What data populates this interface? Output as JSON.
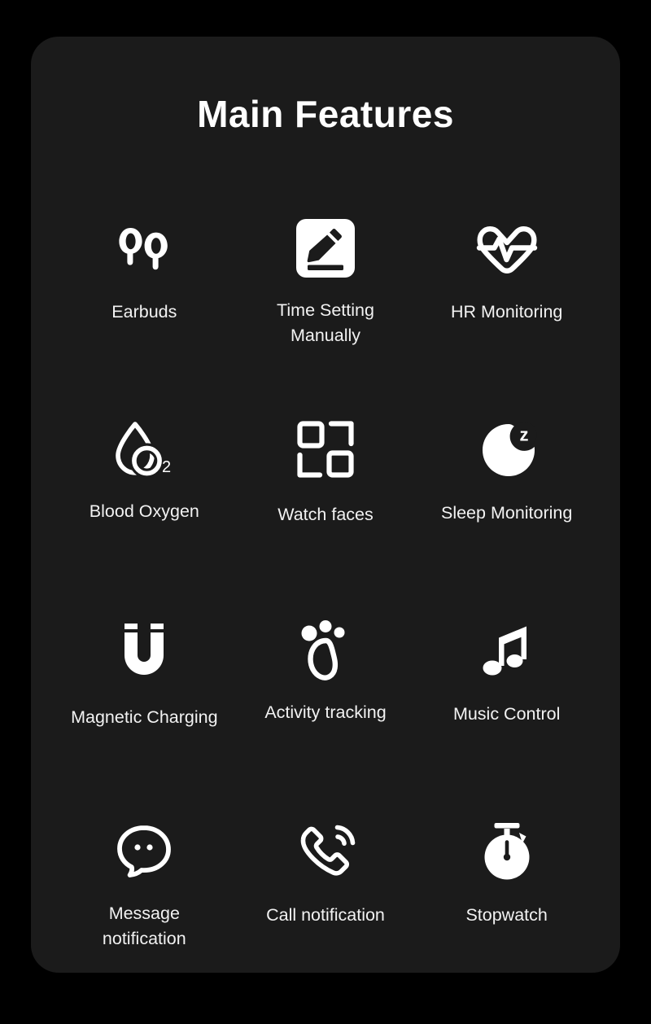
{
  "theme": {
    "page_background": "#000000",
    "card_background": "#1b1b1b",
    "text_color": "#ffffff",
    "icon_color": "#ffffff"
  },
  "card": {
    "title": "Main Features"
  },
  "features": [
    {
      "label": "Earbuds",
      "icon": "earbuds-icon"
    },
    {
      "label": "Time Setting\nManually",
      "icon": "pencil-edit-square-icon"
    },
    {
      "label": "HR Monitoring",
      "icon": "heart-pulse-icon"
    },
    {
      "label": "Blood Oxygen",
      "icon": "water-drop-o2-icon"
    },
    {
      "label": "Watch faces",
      "icon": "watch-faces-squares-icon"
    },
    {
      "label": "Sleep Monitoring",
      "icon": "moon-z-icon"
    },
    {
      "label": "Magnetic Charging",
      "icon": "horseshoe-magnet-icon"
    },
    {
      "label": "Activity tracking",
      "icon": "footprint-icon"
    },
    {
      "label": "Music Control",
      "icon": "music-note-icon"
    },
    {
      "label": "Message\nnotification",
      "icon": "speech-bubble-icon"
    },
    {
      "label": "Call notification",
      "icon": "phone-handset-icon"
    },
    {
      "label": "Stopwatch",
      "icon": "stopwatch-icon"
    }
  ]
}
